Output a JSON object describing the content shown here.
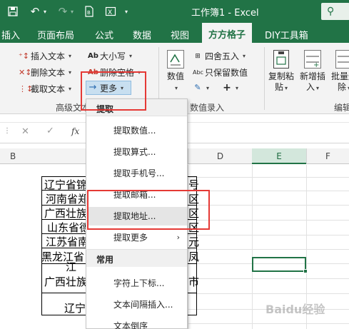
{
  "titlebar": {
    "title": "工作簿1 - Excel",
    "save_icon": "save-icon",
    "undo_icon": "undo-icon",
    "redo_icon": "redo-icon",
    "search_icon": "search-icon"
  },
  "tabs": [
    "插入",
    "页面布局",
    "公式",
    "数据",
    "视图",
    "方方格子",
    "DIY工具箱"
  ],
  "active_tab": "方方格子",
  "ribbon": {
    "insert_text": "插入文本",
    "delete_text": "删除文本",
    "cut_text": "截取文本",
    "font_size": "大小写",
    "delete_space": "删除空格",
    "more": "更多",
    "group_advanced_text": "高级文本",
    "value_label": "数值",
    "round": "四舍五入",
    "keep_value": "只保留数值",
    "group_value_entry": "数值录入",
    "copy_paste": [
      "复制粘",
      "贴"
    ],
    "new_insert": [
      "新增插",
      "入"
    ],
    "batch_delete": [
      "批量删",
      "除"
    ],
    "group_edit": "编辑"
  },
  "formula_bar": {
    "fx": "fx"
  },
  "columns": [
    "B",
    "D",
    "E",
    "F"
  ],
  "cells": {
    "row1": "辽宁省锦",
    "row1_tail": "号",
    "row2": "河南省郑",
    "row2_tail": "区",
    "row3": "广西壮族",
    "row3_tail": "区",
    "row4": "山东省德",
    "row4_tail": "区",
    "row5": "江苏省南",
    "row5_tail": "元",
    "row6": "黑龙江省",
    "row6_tail": "凤",
    "row7": "江",
    "row8": "广西壮族",
    "row8_tail": "市",
    "row9": "辽宁"
  },
  "menu": {
    "section_extract": "提取",
    "items_extract": [
      "提取数值...",
      "提取算式...",
      "提取手机号...",
      "提取邮箱...",
      "提取地址...",
      "提取更多"
    ],
    "section_common": "常用",
    "items_common": [
      "字符上下标...",
      "文本间隔插入...",
      "文本倒序"
    ]
  },
  "colors": {
    "excel_green": "#217346",
    "highlight_red": "#e53935"
  },
  "watermark": "Baidu经验"
}
